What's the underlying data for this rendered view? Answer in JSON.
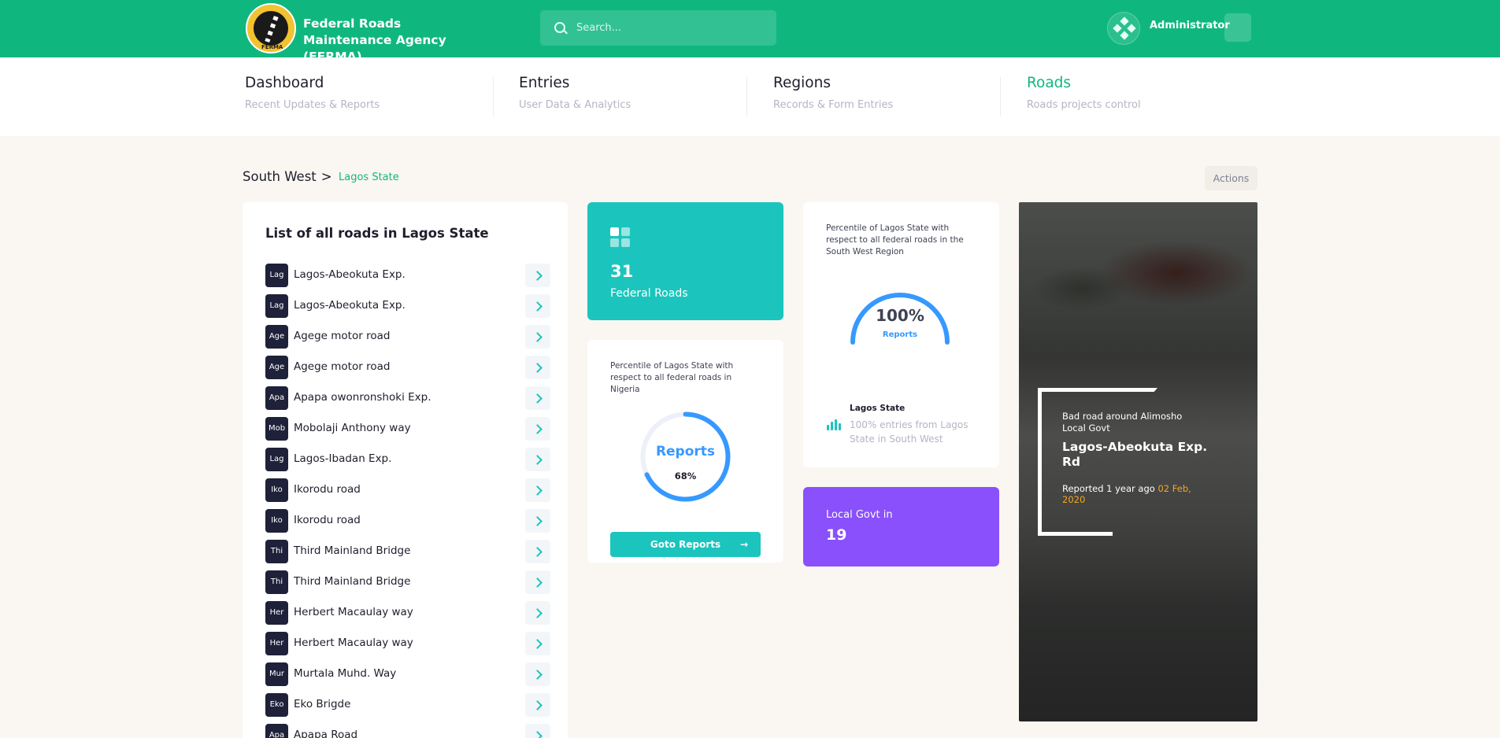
{
  "header": {
    "brand": "Federal Roads Maintenance Agency (FERMA)",
    "logo_text": "FERMA",
    "search_placeholder": "Search...",
    "user_name": "Administrator"
  },
  "nav": [
    {
      "title": "Dashboard",
      "subtitle": "Recent Updates & Reports"
    },
    {
      "title": "Entries",
      "subtitle": "User Data & Analytics"
    },
    {
      "title": "Regions",
      "subtitle": "Records & Form Entries"
    },
    {
      "title": "Roads",
      "subtitle": "Roads projects control",
      "active": true
    }
  ],
  "breadcrumb": {
    "region": "South West",
    "separator": ">",
    "current": "Lagos State"
  },
  "actions_label": "Actions",
  "roads_list": {
    "title": "List of all roads in Lagos State",
    "items": [
      {
        "abbr": "Lag",
        "name": "Lagos-Abeokuta Exp."
      },
      {
        "abbr": "Lag",
        "name": "Lagos-Abeokuta Exp."
      },
      {
        "abbr": "Age",
        "name": "Agege motor road"
      },
      {
        "abbr": "Age",
        "name": "Agege motor road"
      },
      {
        "abbr": "Apa",
        "name": "Apapa owonronshoki Exp."
      },
      {
        "abbr": "Mob",
        "name": "Mobolaji Anthony way"
      },
      {
        "abbr": "Lag",
        "name": "Lagos-Ibadan Exp."
      },
      {
        "abbr": "Iko",
        "name": "Ikorodu road"
      },
      {
        "abbr": "Iko",
        "name": "Ikorodu road"
      },
      {
        "abbr": "Thi",
        "name": "Third Mainland Bridge"
      },
      {
        "abbr": "Thi",
        "name": "Third Mainland Bridge"
      },
      {
        "abbr": "Her",
        "name": "Herbert Macaulay way"
      },
      {
        "abbr": "Her",
        "name": "Herbert Macaulay way"
      },
      {
        "abbr": "Mur",
        "name": "Murtala Muhd. Way"
      },
      {
        "abbr": "Eko",
        "name": "Eko Brigde"
      },
      {
        "abbr": "Apa",
        "name": "Apapa Road"
      }
    ]
  },
  "federal_roads": {
    "count": "31",
    "label": "Federal Roads"
  },
  "nigeria_percentile": {
    "description": "Percentile of Lagos State with respect to all federal roads in Nigeria",
    "label": "Reports",
    "value_text": "68%",
    "value": 0.68,
    "button": "Goto Reports"
  },
  "southwest_percentile": {
    "description": "Percentile of Lagos State with respect to all federal roads in the South West Region",
    "value_text": "100%",
    "value": 1.0,
    "label": "Reports",
    "stat_title": "Lagos State",
    "stat_desc": "100% entries from Lagos State in South West"
  },
  "lga": {
    "label": "Local Govt in",
    "count": "19"
  },
  "photo": {
    "subtitle": "Bad road around Alimosho Local Govt",
    "title": "Lagos-Abeokuta Exp. Rd",
    "reported": "Reported 1 year ago",
    "date": "02 Feb, 2020"
  },
  "colors": {
    "primary": "#0fb77f",
    "teal": "#1bc5bd",
    "purple": "#8950fc",
    "blue": "#3699ff",
    "dark": "#1e2139",
    "orange": "#f6a524"
  }
}
